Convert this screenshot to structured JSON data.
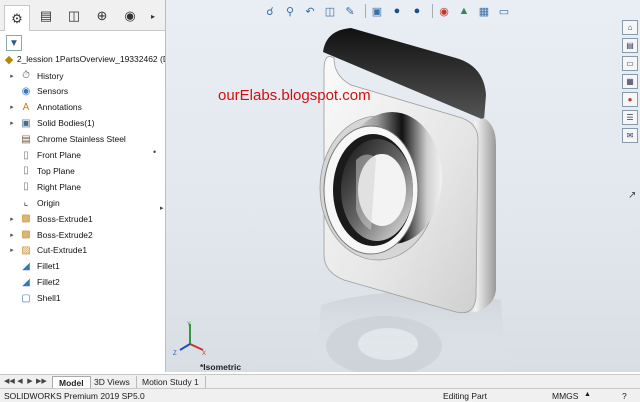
{
  "feature_manager": {
    "tabs": [
      "feature-manager-icon",
      "property-manager-icon",
      "configuration-manager-icon",
      "dimxpert-icon",
      "display-manager-icon"
    ],
    "filter_icon": "filter-icon",
    "part_name": "2_lession 1PartsOverview_19332462  (D",
    "tree": [
      {
        "label": "History",
        "icon": "history-icon",
        "expandable": true
      },
      {
        "label": "Sensors",
        "icon": "sensors-icon",
        "expandable": false
      },
      {
        "label": "Annotations",
        "icon": "annotations-icon",
        "expandable": true
      },
      {
        "label": "Solid Bodies(1)",
        "icon": "solid-bodies-icon",
        "expandable": true
      },
      {
        "label": "Chrome Stainless Steel",
        "icon": "material-icon",
        "expandable": false
      },
      {
        "label": "Front Plane",
        "icon": "plane-icon",
        "expandable": false
      },
      {
        "label": "Top Plane",
        "icon": "plane-icon",
        "expandable": false
      },
      {
        "label": "Right Plane",
        "icon": "plane-icon",
        "expandable": false
      },
      {
        "label": "Origin",
        "icon": "origin-icon",
        "expandable": false
      },
      {
        "label": "Boss-Extrude1",
        "icon": "extrude-icon",
        "expandable": true
      },
      {
        "label": "Boss-Extrude2",
        "icon": "extrude-icon",
        "expandable": true
      },
      {
        "label": "Cut-Extrude1",
        "icon": "cut-extrude-icon",
        "expandable": true
      },
      {
        "label": "Fillet1",
        "icon": "fillet-icon",
        "expandable": false
      },
      {
        "label": "Fillet2",
        "icon": "fillet-icon",
        "expandable": false
      },
      {
        "label": "Shell1",
        "icon": "shell-icon",
        "expandable": false
      }
    ]
  },
  "heads_up_toolbar": [
    "zoom-to-fit-icon",
    "zoom-to-area-icon",
    "previous-view-icon",
    "section-view-icon",
    "dynamic-annotation-icon",
    "view-orientation-icon",
    "display-style-icon",
    "hide-show-icon",
    "edit-appearance-icon",
    "apply-scene-icon",
    "view-settings-icon",
    "monitor-icon"
  ],
  "task_pane": [
    "solidworks-resources-icon",
    "design-library-icon",
    "file-explorer-icon",
    "view-palette-icon",
    "appearances-icon",
    "custom-properties-icon",
    "forum-icon"
  ],
  "viewport": {
    "watermark": "ourElabs.blogspot.com",
    "view_label": "*Isometric",
    "axes": {
      "x": "X",
      "y": "Y",
      "z": "Z"
    }
  },
  "bottom_tabs": [
    "Model",
    "3D Views",
    "Motion Study 1"
  ],
  "active_bottom_tab": "Model",
  "status": {
    "product": "SOLIDWORKS Premium 2019 SP5.0",
    "mode": "Editing Part",
    "units": "MMGS"
  },
  "colors": {
    "watermark": "#d01010",
    "viewport_background": "#e6ebf1",
    "accent": "#3a6ea5"
  }
}
